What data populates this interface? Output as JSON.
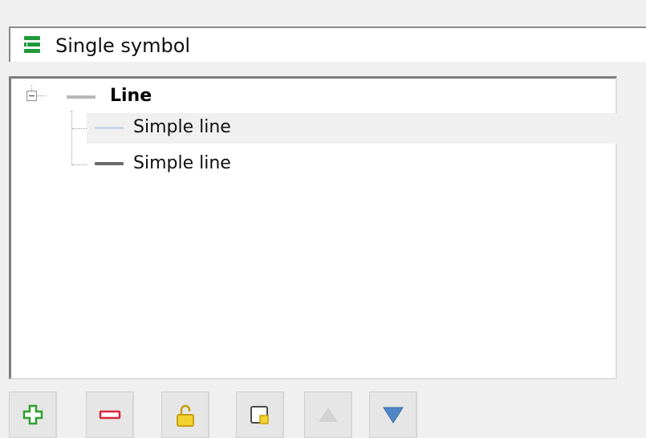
{
  "renderer": {
    "type_label": "Single symbol",
    "icon": "single-symbol-icon"
  },
  "symbol_tree": {
    "root": {
      "label": "Line",
      "expanded": true,
      "swatch_color": "#b8b8b8"
    },
    "layers": [
      {
        "label": "Simple line",
        "swatch_color": "#c6d6e6",
        "selected": true
      },
      {
        "label": "Simple line",
        "swatch_color": "#6a6a6a",
        "selected": false
      }
    ]
  },
  "toolbar": {
    "buttons": [
      {
        "icon": "add-layer-icon",
        "enabled": true
      },
      {
        "icon": "remove-layer-icon",
        "enabled": true
      },
      {
        "icon": "unlock-icon",
        "enabled": true
      },
      {
        "icon": "duplicate-layer-icon",
        "enabled": true
      },
      {
        "icon": "move-up-icon",
        "enabled": false
      },
      {
        "icon": "move-down-icon",
        "enabled": true
      }
    ]
  },
  "colors": {
    "add_icon": "#2e9e2e",
    "remove_icon": "#d9253a",
    "lock_icon": "#e8c21c",
    "arrow_down": "#4f86c6",
    "arrow_up_disabled": "#c8c8c8"
  }
}
